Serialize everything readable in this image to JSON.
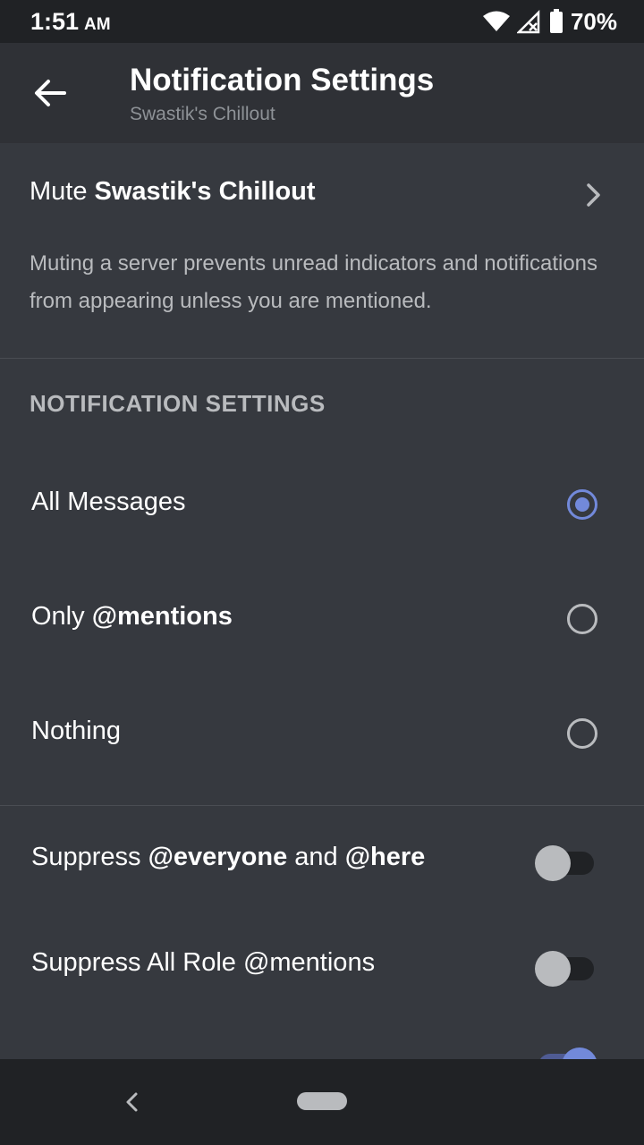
{
  "status_bar": {
    "time": "1:51",
    "ampm": "AM",
    "battery": "70%",
    "icons": [
      "wifi-icon",
      "cellular-no-signal-icon",
      "battery-icon"
    ]
  },
  "header": {
    "title": "Notification Settings",
    "subtitle": "Swastik's Chillout",
    "back_icon": "arrow-left-icon"
  },
  "mute": {
    "prefix": "Mute ",
    "server": "Swastik's Chillout",
    "description": "Muting a server prevents unread indicators and notifications from appearing unless you are mentioned."
  },
  "notification_section": {
    "header": "NOTIFICATION SETTINGS",
    "options": [
      {
        "label": "All Messages",
        "selected": true
      },
      {
        "label_prefix": "Only ",
        "label_bold": "@mentions",
        "selected": false
      },
      {
        "label": "Nothing",
        "selected": false
      }
    ]
  },
  "toggles": {
    "suppress_everyone": {
      "prefix": "Suppress ",
      "bold1": "@everyone",
      "mid": " and ",
      "bold2": "@here",
      "enabled": false
    },
    "suppress_roles": {
      "label": "Suppress All Role @mentions",
      "enabled": false
    },
    "partial_third": {
      "enabled": true
    }
  },
  "colors": {
    "accent": "#7289da",
    "background": "#36393f",
    "header_bg": "#2f3136",
    "statusbar_bg": "#202225"
  }
}
